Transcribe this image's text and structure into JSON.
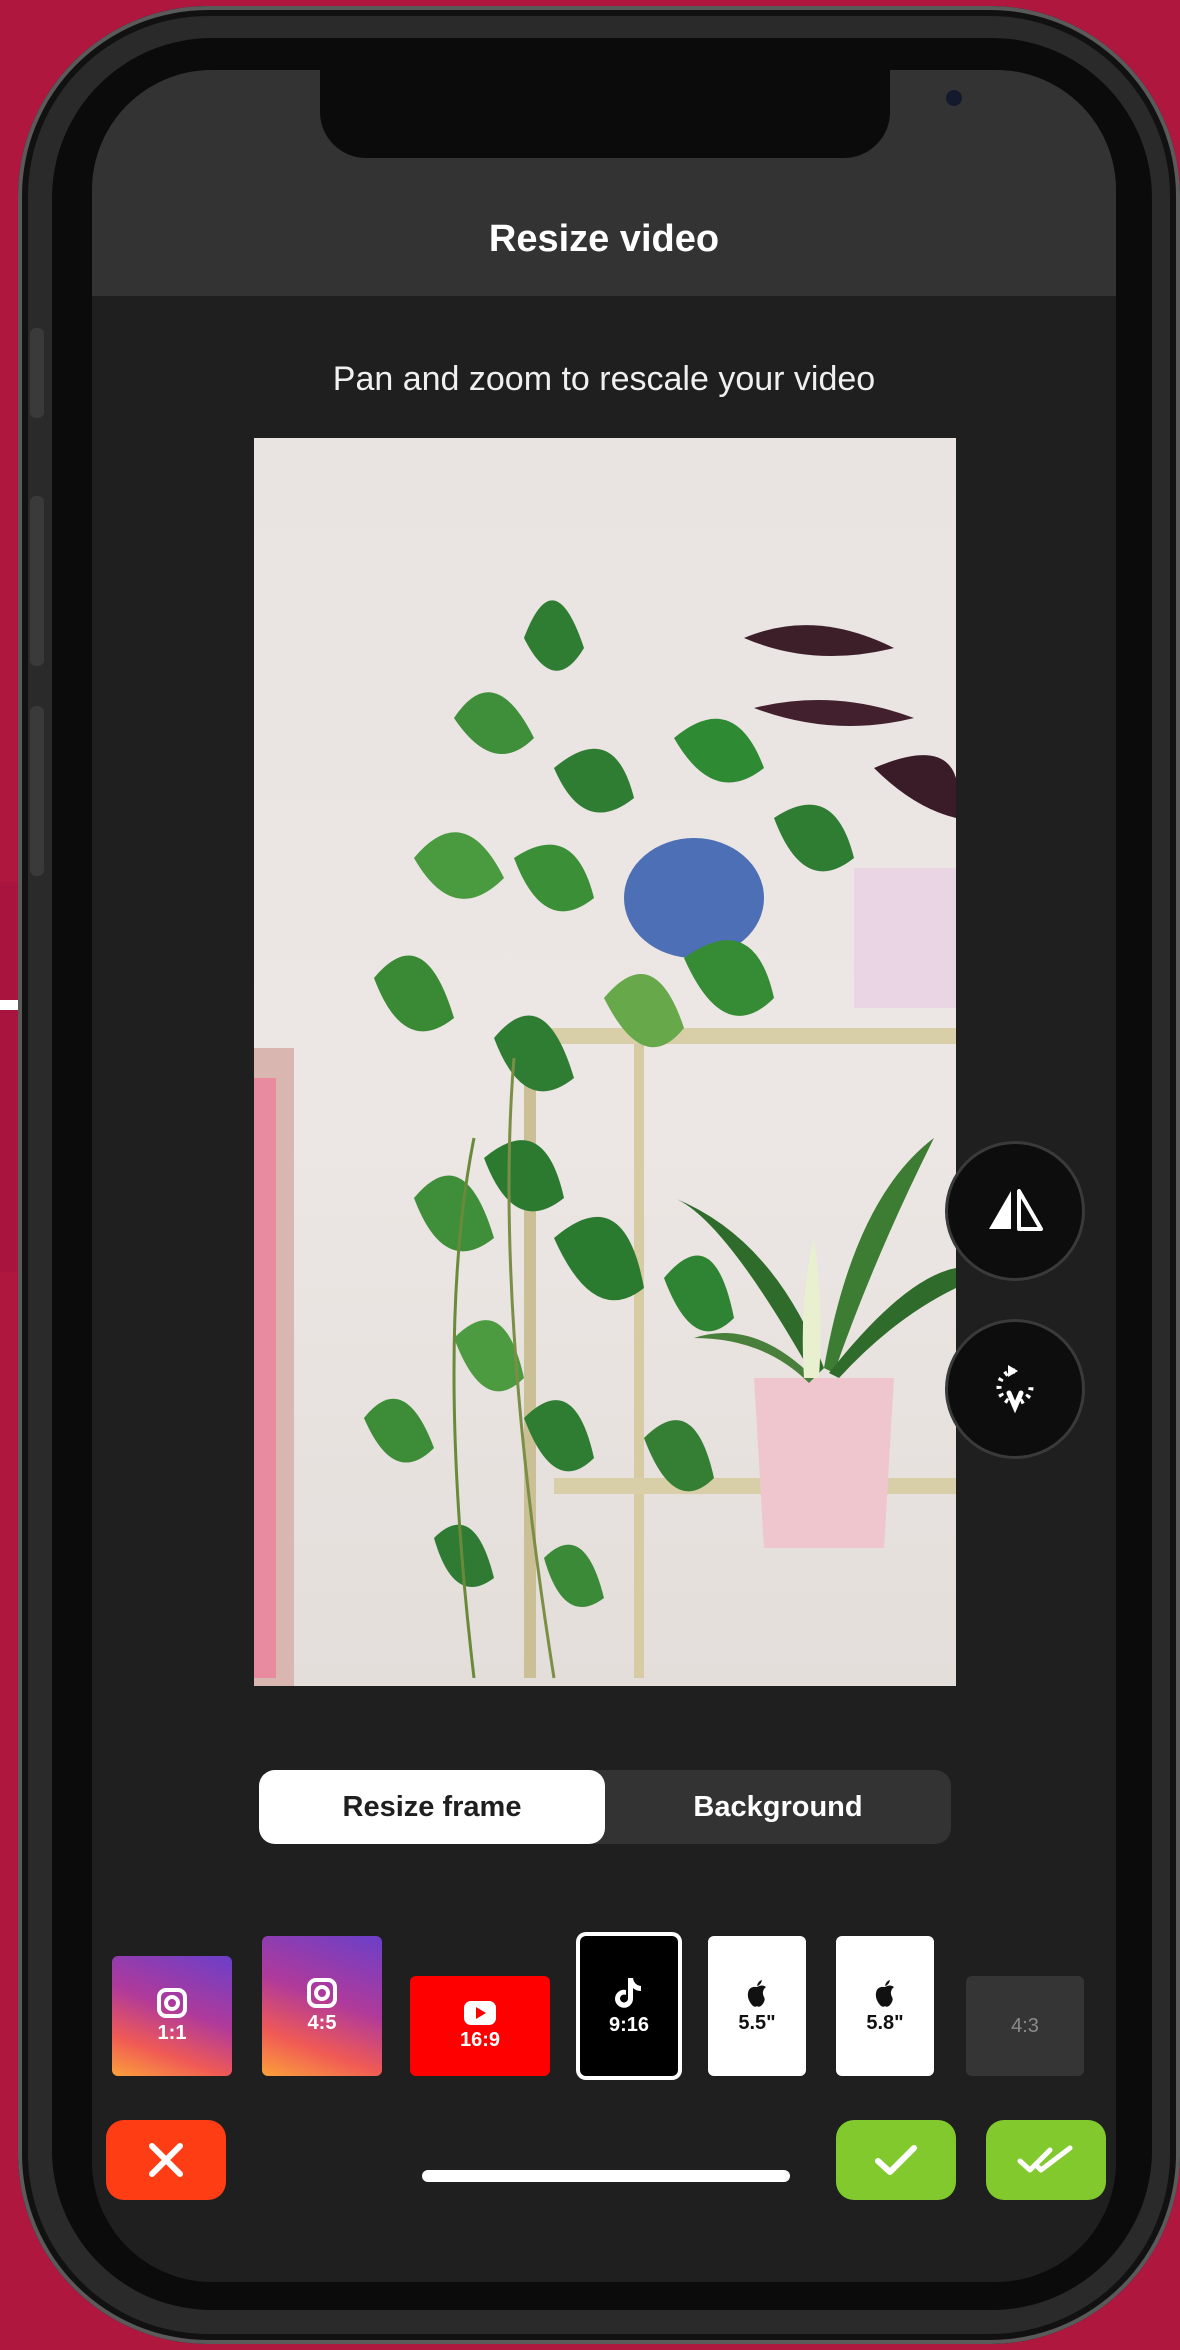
{
  "header": {
    "title": "Resize video"
  },
  "instructions": "Pan and zoom to rescale your video",
  "tabs": [
    {
      "label": "Resize frame",
      "active": true
    },
    {
      "label": "Background",
      "active": false
    }
  ],
  "presets": [
    {
      "label": "1:1",
      "icon": "instagram-icon",
      "selected": false
    },
    {
      "label": "4:5",
      "icon": "instagram-icon",
      "selected": false
    },
    {
      "label": "16:9",
      "icon": "youtube-icon",
      "selected": false
    },
    {
      "label": "9:16",
      "icon": "tiktok-icon",
      "selected": true
    },
    {
      "label": "5.5\"",
      "icon": "apple-icon",
      "selected": false
    },
    {
      "label": "5.8\"",
      "icon": "apple-icon",
      "selected": false
    },
    {
      "label": "4:3",
      "icon": "",
      "selected": false
    }
  ],
  "actions": {
    "cancel_icon": "close-icon",
    "apply_icon": "check-icon",
    "apply_all_icon": "double-check-icon"
  },
  "tools": {
    "flip_icon": "flip-icon",
    "rotate_icon": "rotate-icon"
  },
  "colors": {
    "brand_background": "#b0173f",
    "cancel": "#ff3d14",
    "confirm": "#82c92e",
    "youtube": "#ff0000"
  }
}
